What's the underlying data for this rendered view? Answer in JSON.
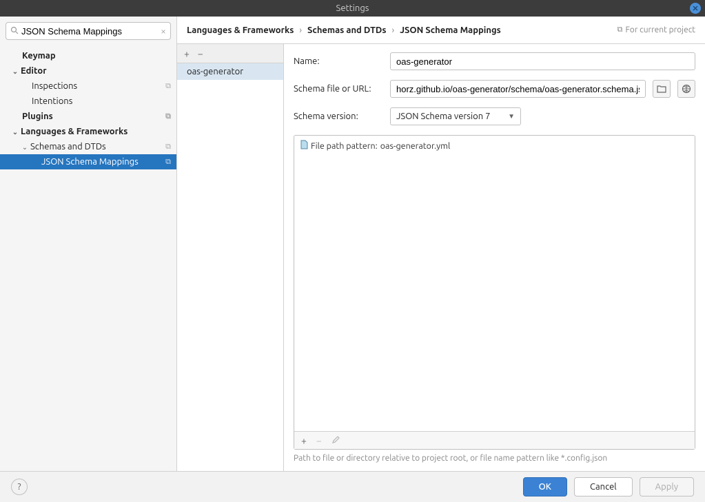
{
  "window": {
    "title": "Settings"
  },
  "search": {
    "value": "JSON Schema Mappings"
  },
  "tree": {
    "keymap": "Keymap",
    "editor": "Editor",
    "inspections": "Inspections",
    "intentions": "Intentions",
    "plugins": "Plugins",
    "lang_fw": "Languages & Frameworks",
    "schemas_dtds": "Schemas and DTDs",
    "json_schema_mappings": "JSON Schema Mappings"
  },
  "breadcrumb": {
    "a": "Languages & Frameworks",
    "b": "Schemas and DTDs",
    "c": "JSON Schema Mappings"
  },
  "scope_label": "For current project",
  "mappings": {
    "item0": "oas-generator"
  },
  "form": {
    "name_label": "Name:",
    "name_value": "oas-generator",
    "url_label": "Schema file or URL:",
    "url_value": "horz.github.io/oas-generator/schema/oas-generator.schema.json",
    "version_label": "Schema version:",
    "version_value": "JSON Schema version 7",
    "file_pattern_label": "File path pattern: ",
    "file_pattern_value": "oas-generator.yml",
    "hint": "Path to file or directory relative to project root, or file name pattern like *.config.json"
  },
  "buttons": {
    "ok": "OK",
    "cancel": "Cancel",
    "apply": "Apply"
  }
}
